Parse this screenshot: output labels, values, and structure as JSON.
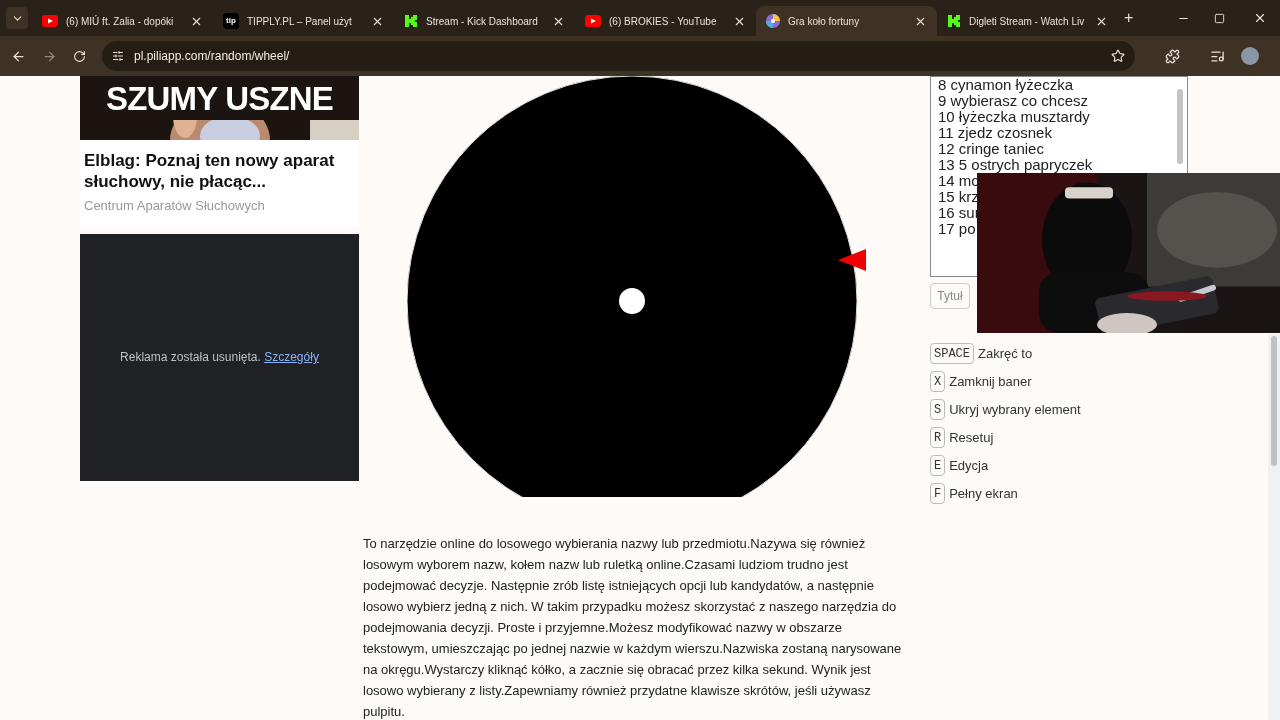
{
  "tabs": [
    {
      "kind": "youtube",
      "title": "(6) MIÚ ft. Zalia - dopóki",
      "selected": false
    },
    {
      "kind": "tipply",
      "title": "TIPPLY.PL – Panel użyt",
      "selected": false
    },
    {
      "kind": "kick",
      "title": "Stream - Kick Dashboard",
      "selected": false
    },
    {
      "kind": "youtube",
      "title": "(6) BROKIES - YouTube",
      "selected": false
    },
    {
      "kind": "wheel",
      "title": "Gra koło fortuny",
      "selected": true
    },
    {
      "kind": "kick",
      "title": "Digleti Stream - Watch Liv",
      "selected": false
    }
  ],
  "tipply_label": "tip",
  "new_tab": "+",
  "address": "pl.piliapp.com/random/wheel/",
  "ad": {
    "image_text": "SZUMY USZNE",
    "headline": "Elblag: Poznaj ten nowy aparat słuchowy, nie płacąc...",
    "source": "Centrum Aparatów Słuchowych"
  },
  "removed_ad": {
    "text": "Reklama została usunięta.",
    "link": "Szczegóły"
  },
  "names_list": [
    "8 cynamon łyżeczka",
    "9 wybierasz co chcesz",
    "10 łyżeczka musztardy",
    "11 zjedz czosnek",
    "12 cringe taniec",
    "13 5 ostrych papryczek",
    "14 mo",
    "15 krz",
    "16 sur",
    "17 po"
  ],
  "title_button": "Tytuł",
  "shortcuts": [
    {
      "key": "SPACE",
      "label": "Zakręć to"
    },
    {
      "key": "X",
      "label": "Zamknij baner"
    },
    {
      "key": "S",
      "label": "Ukryj wybrany element"
    },
    {
      "key": "R",
      "label": "Resetuj"
    },
    {
      "key": "E",
      "label": "Edycja"
    },
    {
      "key": "F",
      "label": "Pełny ekran"
    }
  ],
  "description": "To narzędzie online do losowego wybierania nazwy lub przedmiotu.Nazywa się również losowym wyborem nazw, kołem nazw lub ruletką online.Czasami ludziom trudno jest podejmować decyzje. Następnie zrób listę istniejących opcji lub kandydatów, a następnie losowo wybierz jedną z nich. W takim przypadku możesz skorzystać z naszego narzędzia do podejmowania decyzji. Proste i przyjemne.Możesz modyfikować nazwy w obszarze tekstowym, umieszczając po jednej nazwie w każdym wierszu.Nazwiska zostaną narysowane na okręgu.Wystarczy kliknąć kółko, a zacznie się obracać przez kilka sekund. Wynik jest losowo wybierany z listy.Zapewniamy również przydatne klawisze skrótów, jeśli używasz pulpitu."
}
